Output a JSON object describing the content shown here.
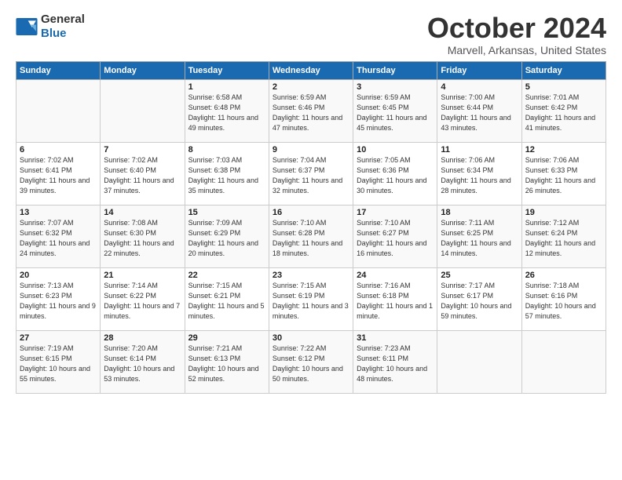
{
  "header": {
    "logo_general": "General",
    "logo_blue": "Blue",
    "month": "October 2024",
    "location": "Marvell, Arkansas, United States"
  },
  "days_of_week": [
    "Sunday",
    "Monday",
    "Tuesday",
    "Wednesday",
    "Thursday",
    "Friday",
    "Saturday"
  ],
  "weeks": [
    [
      {
        "day": "",
        "sunrise": "",
        "sunset": "",
        "daylight": ""
      },
      {
        "day": "",
        "sunrise": "",
        "sunset": "",
        "daylight": ""
      },
      {
        "day": "1",
        "sunrise": "Sunrise: 6:58 AM",
        "sunset": "Sunset: 6:48 PM",
        "daylight": "Daylight: 11 hours and 49 minutes."
      },
      {
        "day": "2",
        "sunrise": "Sunrise: 6:59 AM",
        "sunset": "Sunset: 6:46 PM",
        "daylight": "Daylight: 11 hours and 47 minutes."
      },
      {
        "day": "3",
        "sunrise": "Sunrise: 6:59 AM",
        "sunset": "Sunset: 6:45 PM",
        "daylight": "Daylight: 11 hours and 45 minutes."
      },
      {
        "day": "4",
        "sunrise": "Sunrise: 7:00 AM",
        "sunset": "Sunset: 6:44 PM",
        "daylight": "Daylight: 11 hours and 43 minutes."
      },
      {
        "day": "5",
        "sunrise": "Sunrise: 7:01 AM",
        "sunset": "Sunset: 6:42 PM",
        "daylight": "Daylight: 11 hours and 41 minutes."
      }
    ],
    [
      {
        "day": "6",
        "sunrise": "Sunrise: 7:02 AM",
        "sunset": "Sunset: 6:41 PM",
        "daylight": "Daylight: 11 hours and 39 minutes."
      },
      {
        "day": "7",
        "sunrise": "Sunrise: 7:02 AM",
        "sunset": "Sunset: 6:40 PM",
        "daylight": "Daylight: 11 hours and 37 minutes."
      },
      {
        "day": "8",
        "sunrise": "Sunrise: 7:03 AM",
        "sunset": "Sunset: 6:38 PM",
        "daylight": "Daylight: 11 hours and 35 minutes."
      },
      {
        "day": "9",
        "sunrise": "Sunrise: 7:04 AM",
        "sunset": "Sunset: 6:37 PM",
        "daylight": "Daylight: 11 hours and 32 minutes."
      },
      {
        "day": "10",
        "sunrise": "Sunrise: 7:05 AM",
        "sunset": "Sunset: 6:36 PM",
        "daylight": "Daylight: 11 hours and 30 minutes."
      },
      {
        "day": "11",
        "sunrise": "Sunrise: 7:06 AM",
        "sunset": "Sunset: 6:34 PM",
        "daylight": "Daylight: 11 hours and 28 minutes."
      },
      {
        "day": "12",
        "sunrise": "Sunrise: 7:06 AM",
        "sunset": "Sunset: 6:33 PM",
        "daylight": "Daylight: 11 hours and 26 minutes."
      }
    ],
    [
      {
        "day": "13",
        "sunrise": "Sunrise: 7:07 AM",
        "sunset": "Sunset: 6:32 PM",
        "daylight": "Daylight: 11 hours and 24 minutes."
      },
      {
        "day": "14",
        "sunrise": "Sunrise: 7:08 AM",
        "sunset": "Sunset: 6:30 PM",
        "daylight": "Daylight: 11 hours and 22 minutes."
      },
      {
        "day": "15",
        "sunrise": "Sunrise: 7:09 AM",
        "sunset": "Sunset: 6:29 PM",
        "daylight": "Daylight: 11 hours and 20 minutes."
      },
      {
        "day": "16",
        "sunrise": "Sunrise: 7:10 AM",
        "sunset": "Sunset: 6:28 PM",
        "daylight": "Daylight: 11 hours and 18 minutes."
      },
      {
        "day": "17",
        "sunrise": "Sunrise: 7:10 AM",
        "sunset": "Sunset: 6:27 PM",
        "daylight": "Daylight: 11 hours and 16 minutes."
      },
      {
        "day": "18",
        "sunrise": "Sunrise: 7:11 AM",
        "sunset": "Sunset: 6:25 PM",
        "daylight": "Daylight: 11 hours and 14 minutes."
      },
      {
        "day": "19",
        "sunrise": "Sunrise: 7:12 AM",
        "sunset": "Sunset: 6:24 PM",
        "daylight": "Daylight: 11 hours and 12 minutes."
      }
    ],
    [
      {
        "day": "20",
        "sunrise": "Sunrise: 7:13 AM",
        "sunset": "Sunset: 6:23 PM",
        "daylight": "Daylight: 11 hours and 9 minutes."
      },
      {
        "day": "21",
        "sunrise": "Sunrise: 7:14 AM",
        "sunset": "Sunset: 6:22 PM",
        "daylight": "Daylight: 11 hours and 7 minutes."
      },
      {
        "day": "22",
        "sunrise": "Sunrise: 7:15 AM",
        "sunset": "Sunset: 6:21 PM",
        "daylight": "Daylight: 11 hours and 5 minutes."
      },
      {
        "day": "23",
        "sunrise": "Sunrise: 7:15 AM",
        "sunset": "Sunset: 6:19 PM",
        "daylight": "Daylight: 11 hours and 3 minutes."
      },
      {
        "day": "24",
        "sunrise": "Sunrise: 7:16 AM",
        "sunset": "Sunset: 6:18 PM",
        "daylight": "Daylight: 11 hours and 1 minute."
      },
      {
        "day": "25",
        "sunrise": "Sunrise: 7:17 AM",
        "sunset": "Sunset: 6:17 PM",
        "daylight": "Daylight: 10 hours and 59 minutes."
      },
      {
        "day": "26",
        "sunrise": "Sunrise: 7:18 AM",
        "sunset": "Sunset: 6:16 PM",
        "daylight": "Daylight: 10 hours and 57 minutes."
      }
    ],
    [
      {
        "day": "27",
        "sunrise": "Sunrise: 7:19 AM",
        "sunset": "Sunset: 6:15 PM",
        "daylight": "Daylight: 10 hours and 55 minutes."
      },
      {
        "day": "28",
        "sunrise": "Sunrise: 7:20 AM",
        "sunset": "Sunset: 6:14 PM",
        "daylight": "Daylight: 10 hours and 53 minutes."
      },
      {
        "day": "29",
        "sunrise": "Sunrise: 7:21 AM",
        "sunset": "Sunset: 6:13 PM",
        "daylight": "Daylight: 10 hours and 52 minutes."
      },
      {
        "day": "30",
        "sunrise": "Sunrise: 7:22 AM",
        "sunset": "Sunset: 6:12 PM",
        "daylight": "Daylight: 10 hours and 50 minutes."
      },
      {
        "day": "31",
        "sunrise": "Sunrise: 7:23 AM",
        "sunset": "Sunset: 6:11 PM",
        "daylight": "Daylight: 10 hours and 48 minutes."
      },
      {
        "day": "",
        "sunrise": "",
        "sunset": "",
        "daylight": ""
      },
      {
        "day": "",
        "sunrise": "",
        "sunset": "",
        "daylight": ""
      }
    ]
  ]
}
